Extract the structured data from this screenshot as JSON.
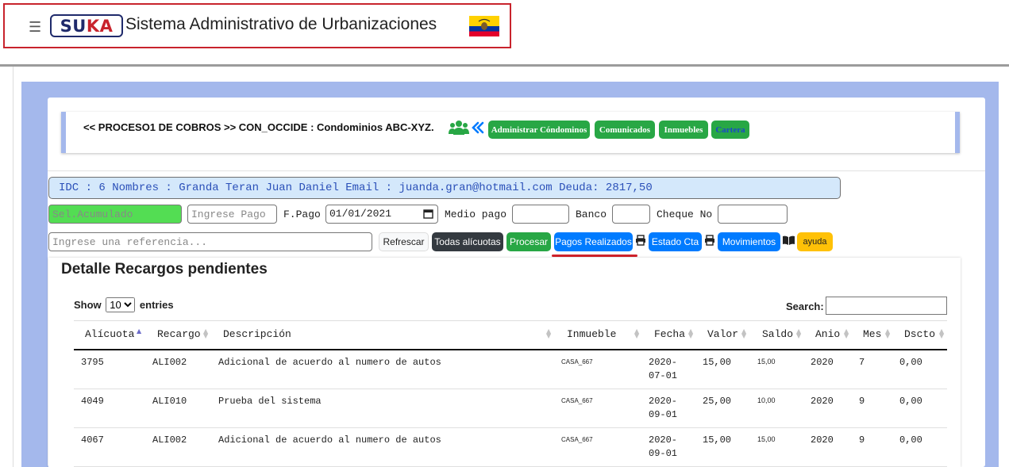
{
  "header": {
    "menu_icon": "hamburger-icon",
    "logo_text": "SUKA",
    "title": "Sistema Administrativo de Urbanizaciones",
    "flag_icon": "ecuador-flag-icon"
  },
  "process": {
    "title": "<< PROCESO1 DE COBROS >> CON_OCCIDE : Condominios ABC-XYZ.",
    "icons": [
      "users-icon",
      "double-chevron-left-icon"
    ],
    "buttons": [
      "Administrar Cóndominos",
      "Comunicados",
      "Inmuebles",
      "Cartera"
    ]
  },
  "info_line": "IDC : 6 Nombres : Granda Teran Juan Daniel Email : juanda.gran@hotmail.com Deuda: 2817,50",
  "form": {
    "acumulado_placeholder": "Sel.Acumulado",
    "pago_placeholder": "Ingrese Pago",
    "fpago_label": "F.Pago",
    "fpago_value": "01/01/2021",
    "medio_pago_label": "Medio pago",
    "banco_label": "Banco",
    "cheque_label": "Cheque No",
    "referencia_placeholder": "Ingrese una referencia..."
  },
  "actions": {
    "refrescar": "Refrescar",
    "todas_alicuotas": "Todas alícuotas",
    "procesar": "Procesar",
    "pagos_realizados": "Pagos Realizados",
    "estado_cta": "Estado Cta",
    "movimientos": "Movimientos",
    "ayuda": "ayuda",
    "icons": [
      "print-icon",
      "book-icon"
    ]
  },
  "detail": {
    "title": "Detalle Recargos pendientes",
    "show_label": "Show",
    "entries_value": "10",
    "entries_label": "entries",
    "search_label": "Search:"
  },
  "table": {
    "headers": [
      "Alícuota",
      "Recargo",
      "Descripción",
      "Inmueble",
      "Fecha",
      "Valor",
      "Saldo",
      "Anio",
      "Mes",
      "Dscto"
    ],
    "rows": [
      {
        "alicuota": "3795",
        "recargo": "ALI002",
        "descripcion": "Adicional de acuerdo al numero de autos",
        "inmueble": "CASA_667",
        "fecha1": "2020-",
        "fecha2": "07-01",
        "valor": "15,00",
        "saldo": "15,00",
        "anio": "2020",
        "mes": "7",
        "dscto": "0,00"
      },
      {
        "alicuota": "4049",
        "recargo": "ALI010",
        "descripcion": "Prueba del sistema",
        "inmueble": "CASA_667",
        "fecha1": "2020-",
        "fecha2": "09-01",
        "valor": "25,00",
        "saldo": "10,00",
        "anio": "2020",
        "mes": "9",
        "dscto": "0,00"
      },
      {
        "alicuota": "4067",
        "recargo": "ALI002",
        "descripcion": "Adicional de acuerdo al numero de autos",
        "inmueble": "CASA_667",
        "fecha1": "2020-",
        "fecha2": "09-01",
        "valor": "15,00",
        "saldo": "15,00",
        "anio": "2020",
        "mes": "9",
        "dscto": "0,00"
      }
    ]
  },
  "colors": {
    "primary": "#007bff",
    "success": "#28a745",
    "dark": "#343a40",
    "warning": "#ffc107",
    "accent_red": "#c8232c",
    "frame_blue": "#a4b8ec",
    "info_bg": "#d4e8fb"
  }
}
